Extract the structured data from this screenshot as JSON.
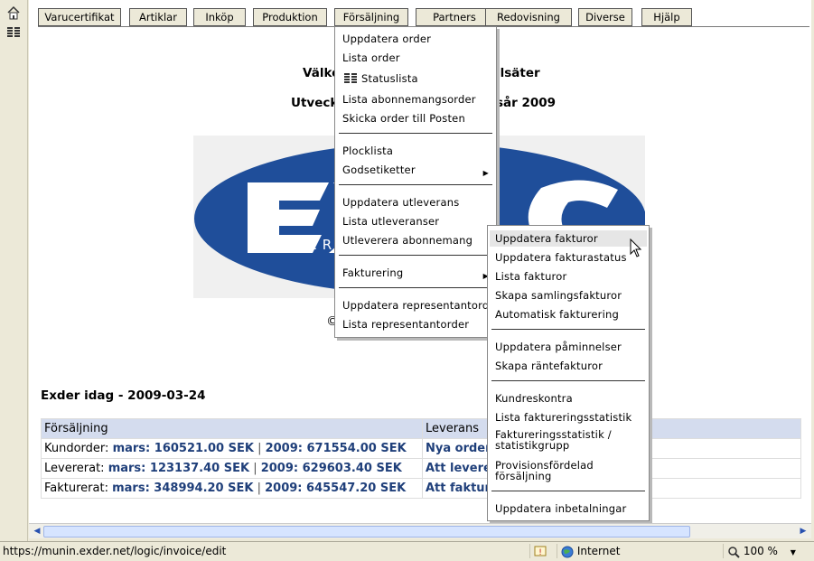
{
  "left_toolbar": {
    "home_icon": "home-icon",
    "list_icon": "list-icon"
  },
  "nav": {
    "tabs": [
      {
        "label": "Varucertifikat"
      },
      {
        "label": "Artiklar"
      },
      {
        "label": "Inköp"
      },
      {
        "label": "Produktion"
      },
      {
        "label": "Försäljning"
      },
      {
        "label": "Partners"
      },
      {
        "label": "Redovisning"
      },
      {
        "label": "Diverse"
      },
      {
        "label": "Hjälp"
      }
    ]
  },
  "page": {
    "welcome_left": "Välko",
    "welcome_right": "llsäter",
    "subtitle_left": "Utveckl",
    "subtitle_right": "sår 2009",
    "logo_text": "EXDER",
    "copyright_symbol": "©",
    "today_title": "Exder idag - 2009-03-24",
    "table": {
      "headers": [
        "Försäljning",
        "Leverans"
      ],
      "rows": [
        {
          "label": "Kundorder:",
          "month": "mars: 160521.00 SEK",
          "year": "2009: 671554.00 SEK",
          "leverans": "Nya order"
        },
        {
          "label": "Levererat:",
          "month": "mars: 123137.40 SEK",
          "year": "2009: 629603.40 SEK",
          "leverans": "Att levere"
        },
        {
          "label": "Fakturerat:",
          "month": "mars: 348994.20 SEK",
          "year": "2009: 645547.20 SEK",
          "leverans": "Att faktur"
        }
      ],
      "separator": "|"
    }
  },
  "menu_forsaljning": {
    "items": [
      "Uppdatera order",
      "Lista order",
      "Statuslista",
      "Lista abonnemangsorder",
      "Skicka order till Posten",
      "Plocklista",
      "Godsetiketter",
      "Uppdatera utleverans",
      "Lista utleveranser",
      "Utleverera abonnemang",
      "Fakturering",
      "Uppdatera representantorder",
      "Lista representantorder"
    ]
  },
  "menu_fakturering": {
    "items": [
      "Uppdatera fakturor",
      "Uppdatera fakturastatus",
      "Lista fakturor",
      "Skapa samlingsfakturor",
      "Automatisk fakturering",
      "Uppdatera påminnelser",
      "Skapa räntefakturor",
      "Kundreskontra",
      "Lista faktureringsstatistik",
      "Faktureringsstatistik / statistikgrupp",
      "Provisionsfördelad försäljning",
      "Uppdatera inbetalningar"
    ]
  },
  "statusbar": {
    "url": "https://munin.exder.net/logic/invoice/edit",
    "zone": "Internet",
    "zoom": "100 %"
  },
  "colors": {
    "accent": "#1f3f7a",
    "logo_blue": "#1f4e9a",
    "header_bg": "#d4dcee"
  }
}
